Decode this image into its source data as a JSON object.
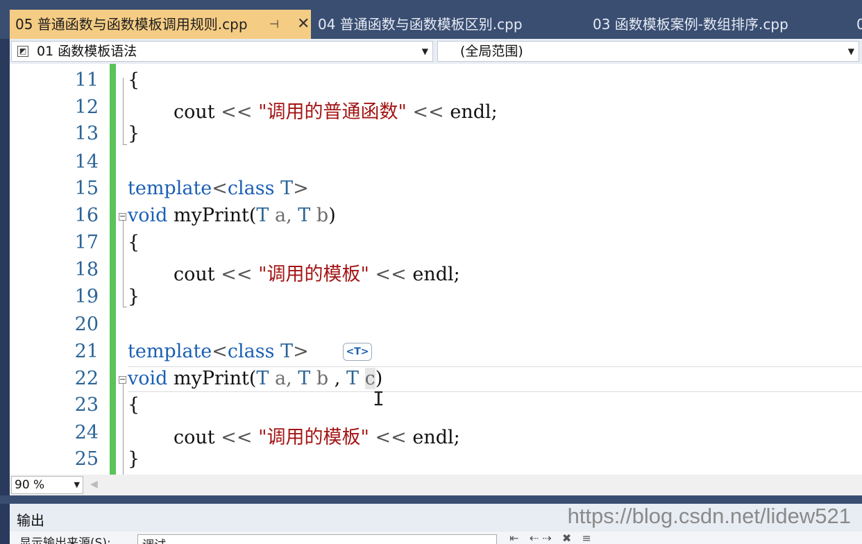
{
  "tabs": [
    {
      "label": "05 普通函数与函数模板调用规则.cpp",
      "active": true,
      "pin": "⊣",
      "close": "✕"
    },
    {
      "label": "04 普通函数与函数模板区别.cpp"
    },
    {
      "label": "03 函数模板案例-数组排序.cpp"
    },
    {
      "label": "0"
    }
  ],
  "nav": {
    "scope_left": "01 函数模板语法",
    "scope_right": "(全局范围)"
  },
  "editor": {
    "line_numbers": [
      "11",
      "12",
      "13",
      "14",
      "15",
      "16",
      "17",
      "18",
      "19",
      "20",
      "21",
      "22",
      "23",
      "24",
      "25"
    ],
    "type_hint": "<T>",
    "code": {
      "l11_brace": "{",
      "l12_cout": "cout",
      "l12_op": "<<",
      "l12_str": "\"调用的普通函数\"",
      "l12_op2": "<<",
      "l12_endl": "endl;",
      "l13_brace": "}",
      "l15_template": "template",
      "l15_lt": "<",
      "l15_class": "class",
      "l15_T": "T",
      "l15_gt": ">",
      "l16_void": "void",
      "l16_fn": "myPrint",
      "l16_open": "(",
      "l16_T1": "T",
      "l16_a": "a,",
      "l16_T2": "T",
      "l16_b": "b",
      "l16_close": ")",
      "l17_brace": "{",
      "l18_cout": "cout",
      "l18_op": "<<",
      "l18_str": "\"调用的模板\"",
      "l18_op2": "<<",
      "l18_endl": "endl;",
      "l19_brace": "}",
      "l21_template": "template",
      "l21_lt": "<",
      "l21_class": "class",
      "l21_T": "T",
      "l21_gt": ">",
      "l22_void": "void",
      "l22_fn": "myPrint",
      "l22_open": "(",
      "l22_T1": "T",
      "l22_a": "a,",
      "l22_T2": "T",
      "l22_b": "b",
      "l22_comma": ",",
      "l22_T3": "T",
      "l22_c": "c",
      "l22_close": ")",
      "l23_brace": "{",
      "l24_cout": "cout",
      "l24_op": "<<",
      "l24_str": "\"调用的模板\"",
      "l24_op2": "<<",
      "l24_endl": "endl;",
      "l25_brace": "}"
    }
  },
  "zoom": {
    "value": "90 %"
  },
  "output": {
    "title": "输出",
    "source_label": "显示输出来源(S):",
    "source_value": "调试"
  },
  "watermark": "https://blog.csdn.net/lidew521",
  "colors": {
    "active_tab": "#f5cc84",
    "keyword": "#1a5fb4",
    "string": "#a31515",
    "line_number": "#2b6496",
    "change_bar": "#5ac35a"
  }
}
